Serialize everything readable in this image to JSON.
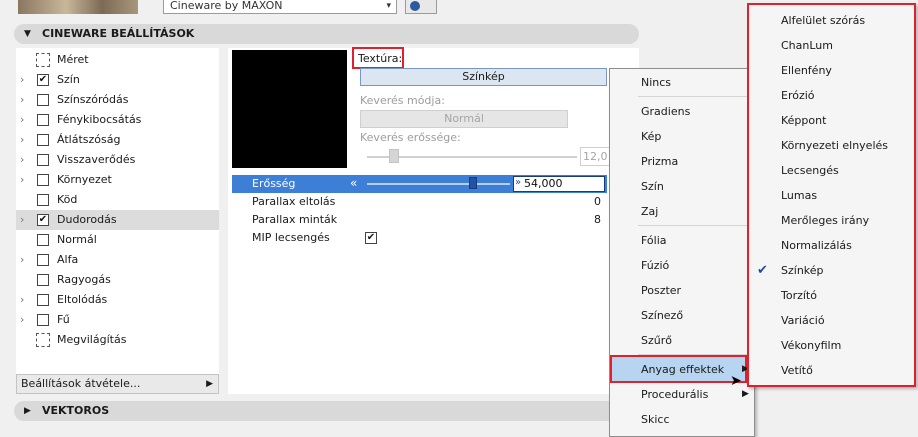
{
  "top": {
    "engine_select": "Cineware by MAXON"
  },
  "sections": {
    "cineware": "CINEWARE BEÁLLÍTÁSOK",
    "vektoros": "VEKTOROS"
  },
  "tree": [
    {
      "label": "Méret",
      "chevron": false,
      "checkbox": "none"
    },
    {
      "label": "Szín",
      "chevron": true,
      "checkbox": "checked"
    },
    {
      "label": "Színszóródás",
      "chevron": true,
      "checkbox": "unchecked"
    },
    {
      "label": "Fénykibocsátás",
      "chevron": true,
      "checkbox": "unchecked"
    },
    {
      "label": "Átlátszóság",
      "chevron": true,
      "checkbox": "unchecked"
    },
    {
      "label": "Visszaverődés",
      "chevron": true,
      "checkbox": "unchecked"
    },
    {
      "label": "Környezet",
      "chevron": true,
      "checkbox": "unchecked"
    },
    {
      "label": "Köd",
      "chevron": false,
      "checkbox": "unchecked"
    },
    {
      "label": "Dudorodás",
      "chevron": true,
      "checkbox": "checked",
      "selected": true
    },
    {
      "label": "Normál",
      "chevron": false,
      "checkbox": "unchecked"
    },
    {
      "label": "Alfa",
      "chevron": true,
      "checkbox": "unchecked"
    },
    {
      "label": "Ragyogás",
      "chevron": false,
      "checkbox": "unchecked"
    },
    {
      "label": "Eltolódás",
      "chevron": true,
      "checkbox": "unchecked"
    },
    {
      "label": "Fű",
      "chevron": true,
      "checkbox": "unchecked"
    },
    {
      "label": "Megvilágítás",
      "chevron": false,
      "checkbox": "none"
    }
  ],
  "transfer_button": "Beállítások átvétele...",
  "texture": {
    "label": "Textúra:",
    "button": "Színkép",
    "blend_mode_label": "Keverés módja:",
    "blend_mode_value": "Normál",
    "blend_strength_label": "Keverés erőssége:",
    "blend_strength_value": "12,0"
  },
  "props": {
    "strength_label": "Erősség",
    "strength_value": "54,000",
    "offset_label": "Parallax eltolás",
    "offset_value": "0",
    "samples_label": "Parallax minták",
    "samples_value": "8",
    "mip_label": "MIP lecsengés"
  },
  "menu1": {
    "items": [
      "Nincs",
      "Gradiens",
      "Kép",
      "Prizma",
      "Szín",
      "Zaj",
      "Fólia",
      "Fúzió",
      "Poszter",
      "Színező",
      "Szűrő",
      "Anyag effektek",
      "Procedurális",
      "Skicc"
    ]
  },
  "menu2": {
    "items": [
      "Alfelület szórás",
      "ChanLum",
      "Ellenfény",
      "Erózió",
      "Képpont",
      "Környezeti elnyelés",
      "Lecsengés",
      "Lumas",
      "Merőleges irány",
      "Normalizálás",
      "Színkép",
      "Torzító",
      "Variáció",
      "Vékonyfilm",
      "Vetítő"
    ],
    "checked": "Színkép"
  },
  "colors": {
    "highlight_red": "#e0202a",
    "selection_blue": "#3d7fd6",
    "menu_hover": "#b7d4f0"
  }
}
